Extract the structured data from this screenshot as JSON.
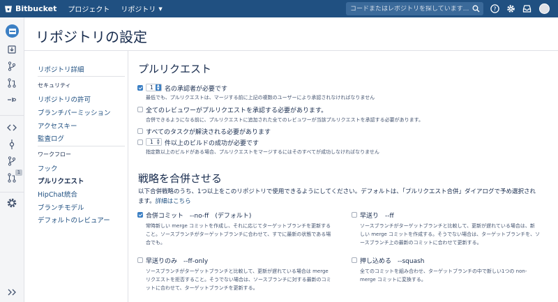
{
  "topbar": {
    "brand": "Bitbucket",
    "nav": [
      "プロジェクト",
      "リポジトリ"
    ],
    "search_placeholder": "コードまたはレポジトリを探しています..."
  },
  "page_title": "リポジトリの設定",
  "sidebar": {
    "repo_details": "リポジトリ詳細",
    "security_head": "セキュリティ",
    "security_items": [
      "リポジトリの許可",
      "ブランチパーミッション",
      "アクセスキー",
      "監査ログ"
    ],
    "workflow_head": "ワークフロー",
    "workflow_items": [
      "フック",
      "プルリクエスト",
      "HipChat統合",
      "ブランチモデル",
      "デフォルトのレビュアー"
    ]
  },
  "rail": {
    "pr_badge": "1"
  },
  "pull_requests": {
    "title": "プルリクエスト",
    "approvers": {
      "checked": true,
      "count": "1",
      "label": "名の承認者が必要です",
      "desc": "最低でも、プルリクエストは、マージする前に上記の複数のユーザーにより承認されなければなりません"
    },
    "all_reviewers": {
      "checked": false,
      "label": "全てのレビュワーがプルリクエストを承認する必要があります。",
      "desc": "合併できるようになる前に、プルリクエストに追加された全てのレビュワーが当該プルリクエストを承認する必要があります。"
    },
    "tasks": {
      "checked": false,
      "label": "すべてのタスクが解決される必要があります"
    },
    "builds": {
      "checked": false,
      "count": "1",
      "label": "件以上のビルドの成功が必要です",
      "desc": "指定数以上のビルドがある場合、プルリクエストをマージするにはそのすべてが成功しなければなりません"
    }
  },
  "merge": {
    "title": "戦略を合併させる",
    "intro_line1": "以下合併戦略のうち、1つ以上をこのリポジトリで使用できるようにしてください。デフォルトは、「プルリクエスト合併」ダイアログで予め選択され",
    "intro_line2_prefix": "ます。",
    "intro_link": "詳細はこちら",
    "strategies": [
      {
        "checked": true,
        "label": "合併コミット　--no-ff　(デフォルト)",
        "desc": [
          "常時新しい merge コミットを作成し、それに応じてターゲットブランチを更新する",
          "こと。ソースブランチがターゲットブランチに合わせて、すでに最新の状態である場",
          "合でも。"
        ]
      },
      {
        "checked": false,
        "label": "早送り　--ff",
        "desc": [
          "ソースブランチがターゲットブランチと比較して、更新が遅れている場合は、新",
          "しい merge コミットを作成する。そうでない場合は、ターゲットブランチを、ソ",
          "ースブランチ上の最新のコミットに合わせて更新する。"
        ]
      },
      {
        "checked": false,
        "label": "早送りのみ　--ff-only",
        "desc": [
          "ソースブランチがターゲットブランチと比較して、更新が遅れている場合は merge",
          "リクエストを拒否すること。そうでない場合は、ソースブランチに対する最新のコミ",
          "ットに合わせて、ターゲットブランチを更新する。"
        ]
      },
      {
        "checked": false,
        "label": "押し込める　--squash",
        "desc": [
          "全てのコミットを組み合わせ、ターゲットブランチの中で新しい1つの non-",
          "merge コミットに変換する。"
        ]
      }
    ]
  }
}
